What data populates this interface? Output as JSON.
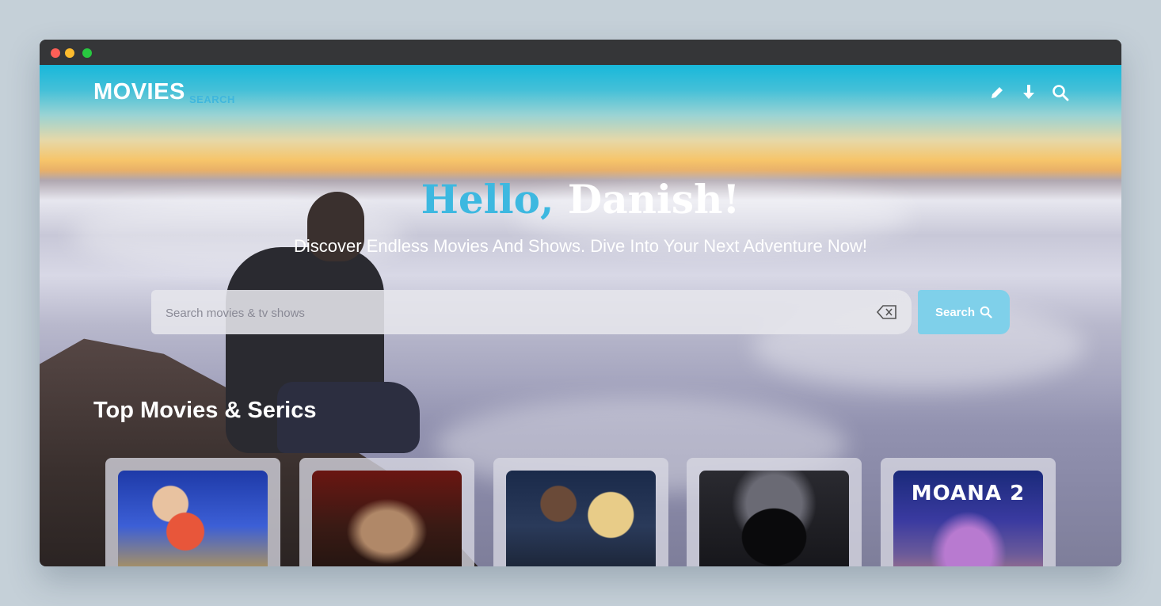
{
  "app": {
    "brand": "MOVIES",
    "brand_sub": "SEARCH"
  },
  "nav": {
    "icons": [
      "pencil-icon",
      "download-icon",
      "search-icon"
    ]
  },
  "hero": {
    "greeting_part1": "Hello,",
    "greeting_part2": "Danish!",
    "tagline": "Discover Endless Movies And Shows. Dive Into Your Next Adventure Now!"
  },
  "search": {
    "placeholder": "Search movies & tv shows",
    "value": "",
    "button_label": "Search"
  },
  "section": {
    "title": "Top Movies & Serics"
  },
  "cards": [
    {
      "poster_text": ""
    },
    {
      "poster_text": ""
    },
    {
      "poster_text": ""
    },
    {
      "poster_text": ""
    },
    {
      "poster_text": "MOANA 2"
    }
  ],
  "colors": {
    "accent": "#3db8e0",
    "search_button": "#7fd0ea",
    "titlebar": "#353638"
  }
}
